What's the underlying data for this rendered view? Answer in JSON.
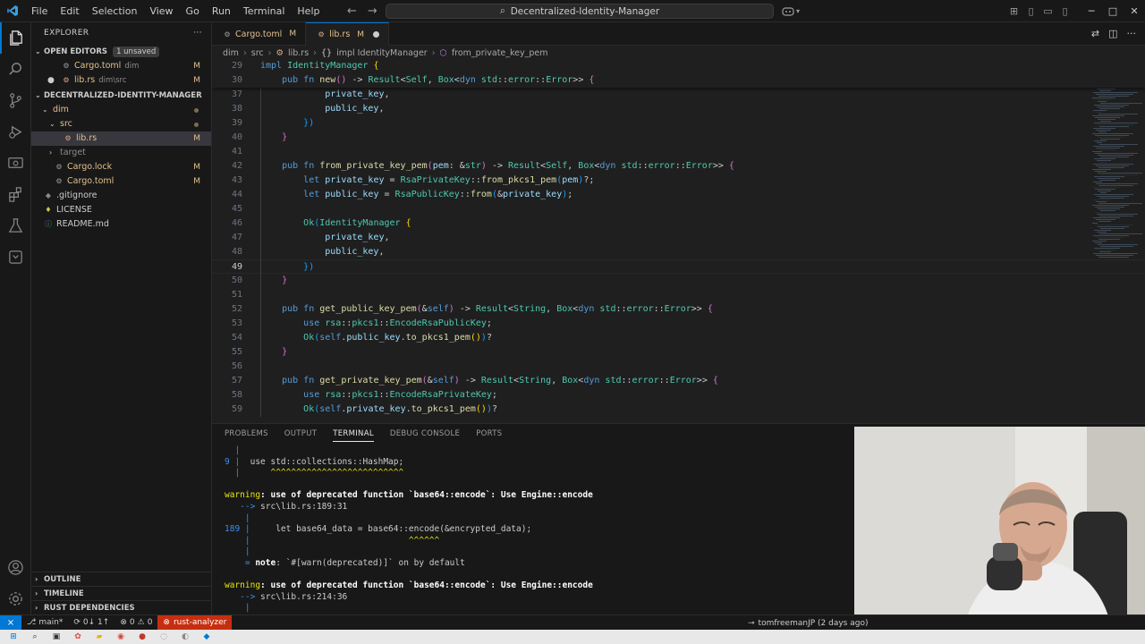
{
  "window": {
    "menus": [
      "File",
      "Edit",
      "Selection",
      "View",
      "Go",
      "Run",
      "Terminal",
      "Help"
    ],
    "command_center": "Decentralized-Identity-Manager"
  },
  "sidebar": {
    "title": "EXPLORER",
    "open_editors": {
      "header": "OPEN EDITORS",
      "badge": "1 unsaved",
      "items": [
        {
          "name": "Cargo.toml",
          "desc": "dim",
          "status": "M"
        },
        {
          "name": "lib.rs",
          "desc": "dim\\src",
          "status": "M"
        }
      ]
    },
    "project": {
      "header": "DECENTRALIZED-IDENTITY-MANAGER",
      "items": [
        {
          "name": "dim",
          "status": ""
        },
        {
          "name": "src",
          "status": ""
        },
        {
          "name": "lib.rs",
          "status": "M"
        },
        {
          "name": "target",
          "status": ""
        },
        {
          "name": "Cargo.lock",
          "status": "M"
        },
        {
          "name": "Cargo.toml",
          "status": "M"
        },
        {
          "name": ".gitignore",
          "status": ""
        },
        {
          "name": "LICENSE",
          "status": ""
        },
        {
          "name": "README.md",
          "status": ""
        }
      ]
    },
    "bottom_sections": [
      "OUTLINE",
      "TIMELINE",
      "RUST DEPENDENCIES"
    ]
  },
  "tabs": [
    {
      "name": "Cargo.toml",
      "status": "M"
    },
    {
      "name": "lib.rs",
      "status": "M"
    }
  ],
  "breadcrumb": [
    "dim",
    "src",
    "lib.rs",
    "impl IdentityManager",
    "from_private_key_pem"
  ],
  "editor": {
    "current_line": "49",
    "lines": [
      {
        "n": "29",
        "tokens": [
          [
            "impl ",
            "kw"
          ],
          [
            "IdentityManager",
            "ty"
          ],
          [
            " {",
            "br1"
          ]
        ]
      },
      {
        "n": "30",
        "tokens": [
          [
            "    "
          ],
          [
            "pub fn ",
            "kw"
          ],
          [
            "new",
            "fn"
          ],
          [
            "() ",
            "br2"
          ],
          [
            "-> "
          ],
          [
            "Result",
            "ty"
          ],
          [
            "<"
          ],
          [
            "Self",
            "ty"
          ],
          [
            ", "
          ],
          [
            "Box",
            "ty"
          ],
          [
            "<"
          ],
          [
            "dyn ",
            "kw"
          ],
          [
            "std",
            "ty"
          ],
          [
            "::"
          ],
          [
            "error",
            "ty"
          ],
          [
            "::"
          ],
          [
            "Error",
            "ty"
          ],
          [
            ">> "
          ],
          [
            "{",
            "br2"
          ]
        ]
      },
      {
        "n": "37",
        "tokens": [
          [
            "            "
          ],
          [
            "private_key",
            "var"
          ],
          [
            ","
          ]
        ]
      },
      {
        "n": "38",
        "tokens": [
          [
            "            "
          ],
          [
            "public_key",
            "var"
          ],
          [
            ","
          ]
        ]
      },
      {
        "n": "39",
        "tokens": [
          [
            "        "
          ],
          [
            "})",
            "br3"
          ]
        ]
      },
      {
        "n": "40",
        "tokens": [
          [
            "    "
          ],
          [
            "}",
            "br2"
          ]
        ]
      },
      {
        "n": "41",
        "tokens": [
          [
            ""
          ]
        ]
      },
      {
        "n": "42",
        "tokens": [
          [
            "    "
          ],
          [
            "pub fn ",
            "kw"
          ],
          [
            "from_private_key_pem",
            "fn"
          ],
          [
            "(",
            "br2"
          ],
          [
            "pem",
            "var"
          ],
          [
            ": &"
          ],
          [
            "str",
            "ty"
          ],
          [
            ") ",
            "br2"
          ],
          [
            "-> "
          ],
          [
            "Result",
            "ty"
          ],
          [
            "<"
          ],
          [
            "Self",
            "ty"
          ],
          [
            ", "
          ],
          [
            "Box",
            "ty"
          ],
          [
            "<"
          ],
          [
            "dyn ",
            "kw"
          ],
          [
            "std",
            "ty"
          ],
          [
            "::"
          ],
          [
            "error",
            "ty"
          ],
          [
            "::"
          ],
          [
            "Error",
            "ty"
          ],
          [
            ">> "
          ],
          [
            "{",
            "br2"
          ]
        ]
      },
      {
        "n": "43",
        "tokens": [
          [
            "        "
          ],
          [
            "let ",
            "kw"
          ],
          [
            "private_key",
            "var"
          ],
          [
            " = "
          ],
          [
            "RsaPrivateKey",
            "ty"
          ],
          [
            "::"
          ],
          [
            "from_pkcs1_pem",
            "fn"
          ],
          [
            "(",
            "br3"
          ],
          [
            "pem",
            "var"
          ],
          [
            ")",
            "br3"
          ],
          [
            "?;"
          ]
        ]
      },
      {
        "n": "44",
        "tokens": [
          [
            "        "
          ],
          [
            "let ",
            "kw"
          ],
          [
            "public_key",
            "var"
          ],
          [
            " = "
          ],
          [
            "RsaPublicKey",
            "ty"
          ],
          [
            "::"
          ],
          [
            "from",
            "fn"
          ],
          [
            "(",
            "br3"
          ],
          [
            "&"
          ],
          [
            "private_key",
            "var"
          ],
          [
            ")",
            "br3"
          ],
          [
            ";"
          ]
        ]
      },
      {
        "n": "45",
        "tokens": [
          [
            ""
          ]
        ]
      },
      {
        "n": "46",
        "tokens": [
          [
            "        "
          ],
          [
            "Ok",
            "ty"
          ],
          [
            "(",
            "br3"
          ],
          [
            "IdentityManager",
            "ty"
          ],
          [
            " {",
            "br1"
          ]
        ]
      },
      {
        "n": "47",
        "tokens": [
          [
            "            "
          ],
          [
            "private_key",
            "var"
          ],
          [
            ","
          ]
        ]
      },
      {
        "n": "48",
        "tokens": [
          [
            "            "
          ],
          [
            "public_key",
            "var"
          ],
          [
            ","
          ]
        ]
      },
      {
        "n": "49",
        "tokens": [
          [
            "        "
          ],
          [
            "})",
            "br3"
          ]
        ]
      },
      {
        "n": "50",
        "tokens": [
          [
            "    "
          ],
          [
            "}",
            "br2"
          ]
        ]
      },
      {
        "n": "51",
        "tokens": [
          [
            ""
          ]
        ]
      },
      {
        "n": "52",
        "tokens": [
          [
            "    "
          ],
          [
            "pub fn ",
            "kw"
          ],
          [
            "get_public_key_pem",
            "fn"
          ],
          [
            "(",
            "br2"
          ],
          [
            "&"
          ],
          [
            "self",
            "kw"
          ],
          [
            ") ",
            "br2"
          ],
          [
            "-> "
          ],
          [
            "Result",
            "ty"
          ],
          [
            "<"
          ],
          [
            "String",
            "ty"
          ],
          [
            ", "
          ],
          [
            "Box",
            "ty"
          ],
          [
            "<"
          ],
          [
            "dyn ",
            "kw"
          ],
          [
            "std",
            "ty"
          ],
          [
            "::"
          ],
          [
            "error",
            "ty"
          ],
          [
            "::"
          ],
          [
            "Error",
            "ty"
          ],
          [
            ">> "
          ],
          [
            "{",
            "br2"
          ]
        ]
      },
      {
        "n": "53",
        "tokens": [
          [
            "        "
          ],
          [
            "use ",
            "kw"
          ],
          [
            "rsa",
            "ty"
          ],
          [
            "::"
          ],
          [
            "pkcs1",
            "ty"
          ],
          [
            "::"
          ],
          [
            "EncodeRsaPublicKey",
            "ty"
          ],
          [
            ";"
          ]
        ]
      },
      {
        "n": "54",
        "tokens": [
          [
            "        "
          ],
          [
            "Ok",
            "ty"
          ],
          [
            "(",
            "br3"
          ],
          [
            "self",
            "kw"
          ],
          [
            "."
          ],
          [
            "public_key",
            "var"
          ],
          [
            "."
          ],
          [
            "to_pkcs1_pem",
            "fn"
          ],
          [
            "()",
            "br1"
          ],
          [
            ")",
            "br3"
          ],
          [
            "?"
          ]
        ]
      },
      {
        "n": "55",
        "tokens": [
          [
            "    "
          ],
          [
            "}",
            "br2"
          ]
        ]
      },
      {
        "n": "56",
        "tokens": [
          [
            ""
          ]
        ]
      },
      {
        "n": "57",
        "tokens": [
          [
            "    "
          ],
          [
            "pub fn ",
            "kw"
          ],
          [
            "get_private_key_pem",
            "fn"
          ],
          [
            "(",
            "br2"
          ],
          [
            "&"
          ],
          [
            "self",
            "kw"
          ],
          [
            ") ",
            "br2"
          ],
          [
            "-> "
          ],
          [
            "Result",
            "ty"
          ],
          [
            "<"
          ],
          [
            "String",
            "ty"
          ],
          [
            ", "
          ],
          [
            "Box",
            "ty"
          ],
          [
            "<"
          ],
          [
            "dyn ",
            "kw"
          ],
          [
            "std",
            "ty"
          ],
          [
            "::"
          ],
          [
            "error",
            "ty"
          ],
          [
            "::"
          ],
          [
            "Error",
            "ty"
          ],
          [
            ">> "
          ],
          [
            "{",
            "br2"
          ]
        ]
      },
      {
        "n": "58",
        "tokens": [
          [
            "        "
          ],
          [
            "use ",
            "kw"
          ],
          [
            "rsa",
            "ty"
          ],
          [
            "::"
          ],
          [
            "pkcs1",
            "ty"
          ],
          [
            "::"
          ],
          [
            "EncodeRsaPrivateKey",
            "ty"
          ],
          [
            ";"
          ]
        ]
      },
      {
        "n": "59",
        "tokens": [
          [
            "        "
          ],
          [
            "Ok",
            "ty"
          ],
          [
            "(",
            "br3"
          ],
          [
            "self",
            "kw"
          ],
          [
            "."
          ],
          [
            "private_key",
            "var"
          ],
          [
            "."
          ],
          [
            "to_pkcs1_pem",
            "fn"
          ],
          [
            "()",
            "br1"
          ],
          [
            ")",
            "br3"
          ],
          [
            "?"
          ]
        ]
      }
    ]
  },
  "panel": {
    "tabs": [
      "PROBLEMS",
      "OUTPUT",
      "TERMINAL",
      "DEBUG CONSOLE",
      "PORTS"
    ],
    "active_tab": "TERMINAL",
    "terminal": [
      [
        [
          "  |",
          "t-blue"
        ]
      ],
      [
        [
          "9 |",
          "t-blue"
        ],
        [
          "  use std::collections::HashMap;"
        ]
      ],
      [
        [
          "  |",
          "t-blue"
        ],
        [
          "      ^^^^^^^^^^^^^^^^^^^^^^^^^^",
          "t-yellow"
        ]
      ],
      [
        [
          ""
        ]
      ],
      [
        [
          "warning",
          "t-yellow"
        ],
        [
          ": use of deprecated function `base64::encode`: Use Engine::encode",
          "t-white"
        ]
      ],
      [
        [
          "   --> ",
          "t-blue"
        ],
        [
          "src\\lib.rs:189:31"
        ]
      ],
      [
        [
          "    |",
          "t-blue"
        ]
      ],
      [
        [
          "189 |",
          "t-blue"
        ],
        [
          "     let base64_data = base64::encode(&encrypted_data);"
        ]
      ],
      [
        [
          "    |",
          "t-blue"
        ],
        [
          "                               ^^^^^^",
          "t-yellow"
        ]
      ],
      [
        [
          "    |",
          "t-blue"
        ]
      ],
      [
        [
          "    = ",
          "t-blue"
        ],
        [
          "note",
          "t-bold"
        ],
        [
          ": `#[warn(deprecated)]` on by default"
        ]
      ],
      [
        [
          ""
        ]
      ],
      [
        [
          "warning",
          "t-yellow"
        ],
        [
          ": use of deprecated function `base64::encode`: Use Engine::encode",
          "t-white"
        ]
      ],
      [
        [
          "   --> ",
          "t-blue"
        ],
        [
          "src\\lib.rs:214:36"
        ]
      ],
      [
        [
          "    |",
          "t-blue"
        ]
      ]
    ]
  },
  "statusbar": {
    "branch": "main*",
    "sync": "0↓ 1↑",
    "errors": "0",
    "warnings": "0",
    "rust_analyzer": "rust-analyzer",
    "blame": "tomfreemanJP (2 days ago)"
  },
  "colors": {
    "accent": "#0078d4",
    "modified": "#e2c08d",
    "rust_analyzer_bg": "#c72e0f"
  }
}
